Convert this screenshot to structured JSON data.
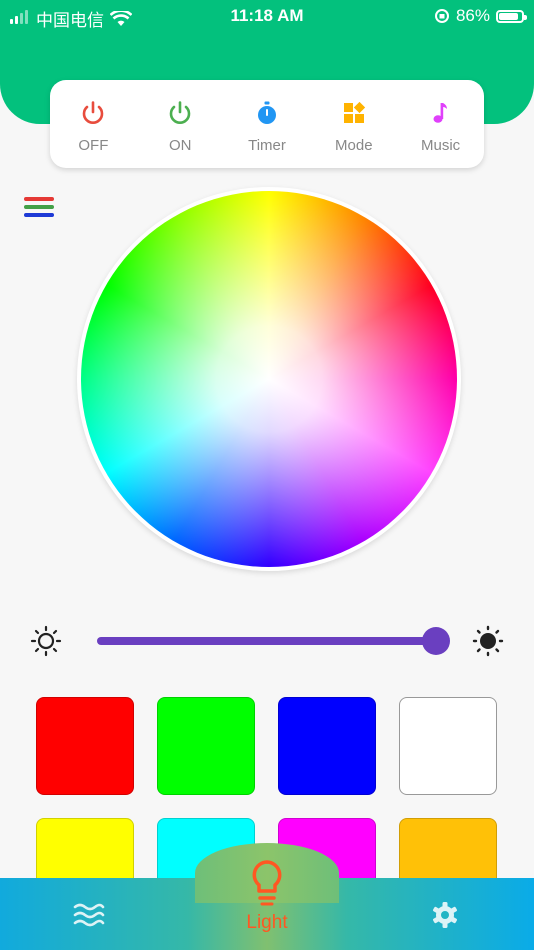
{
  "status_bar": {
    "carrier": "中国电信",
    "time": "11:18 AM",
    "battery": "86%",
    "battery_level": 0.86,
    "icons": [
      "signal-icon",
      "wifi-icon",
      "rotation-lock-icon",
      "battery-icon"
    ]
  },
  "controls": [
    {
      "label": "OFF",
      "icon": "power-off-icon",
      "color": "#e84c3d"
    },
    {
      "label": "ON",
      "icon": "power-on-icon",
      "color": "#4caf50"
    },
    {
      "label": "Timer",
      "icon": "timer-icon",
      "color": "#2196f3"
    },
    {
      "label": "Mode",
      "icon": "mode-grid-icon",
      "color": "#ffb300"
    },
    {
      "label": "Music",
      "icon": "music-note-icon",
      "color": "#e040fb"
    }
  ],
  "menu_icon": {
    "icon": "rgb-lines-icon",
    "colors": [
      "#e53935",
      "#43a047",
      "#1e3ad6"
    ]
  },
  "brightness": {
    "level": 1.0,
    "low_icon": "brightness-low-icon",
    "high_icon": "brightness-high-icon",
    "color": "#6a3fc0"
  },
  "swatches": [
    "#ff0000",
    "#00ff00",
    "#0000ff",
    "#ffffff",
    "#ffff00",
    "#00ffff",
    "#ff00ff",
    "#ffc107"
  ],
  "bottom_nav": {
    "items": [
      {
        "icon": "waves-icon"
      },
      {
        "icon": "bulb-icon",
        "label": "Light",
        "active": true
      },
      {
        "icon": "gear-icon"
      }
    ],
    "active_color": "#ff5722"
  }
}
